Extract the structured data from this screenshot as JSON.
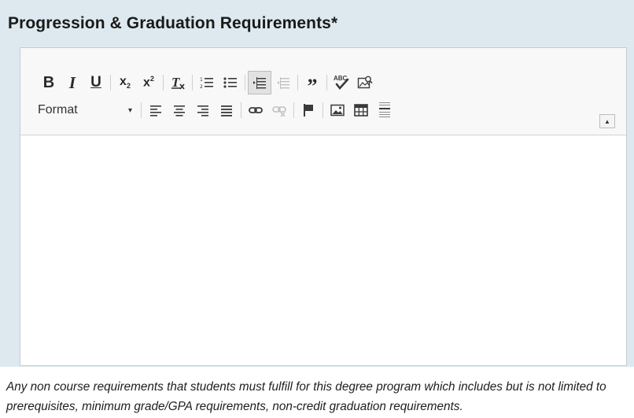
{
  "field": {
    "title": "Progression & Graduation Requirements*",
    "help_text": "Any non course requirements that students must fulfill for this degree program which includes but is not limited to prerequisites, minimum grade/GPA requirements, non-credit graduation requirements."
  },
  "toolbar": {
    "bold": "B",
    "italic": "I",
    "underline": "U",
    "subscript_base": "x",
    "subscript_mark": "2",
    "superscript_base": "x",
    "superscript_mark": "2",
    "blockquote": "”",
    "format_label": "Format",
    "format_caret": "▾",
    "collapse_glyph": "▲"
  },
  "editor": {
    "content": ""
  },
  "icons": {
    "row1": [
      "bold-icon",
      "italic-icon",
      "underline-icon",
      "subscript-icon",
      "superscript-icon",
      "remove-format-icon",
      "numbered-list-icon",
      "bulleted-list-icon",
      "decrease-indent-icon",
      "increase-indent-icon",
      "blockquote-icon",
      "spellcheck-icon",
      "find-replace-icon"
    ],
    "row2": [
      "format-dropdown",
      "align-left-icon",
      "align-center-icon",
      "align-right-icon",
      "justify-icon",
      "link-icon",
      "unlink-icon",
      "anchor-flag-icon",
      "image-icon",
      "table-icon",
      "horizontal-rule-icon",
      "collapse-toolbar-icon"
    ]
  },
  "colors": {
    "panel_bg": "#dde9ee",
    "toolbar_bg": "#f8f8f8",
    "icon": "#3a3a3a",
    "icon_disabled": "#c0c0c0"
  }
}
